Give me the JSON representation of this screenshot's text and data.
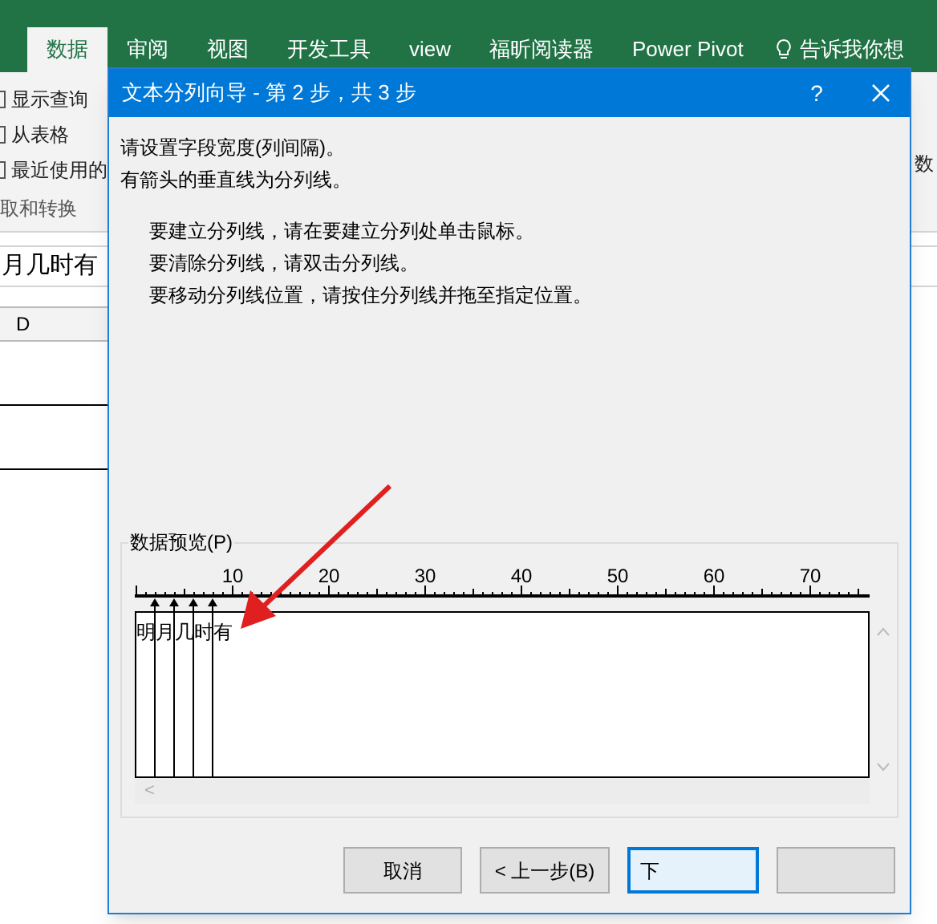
{
  "ribbon_tabs": [
    {
      "label": "数据",
      "selected": true
    },
    {
      "label": "审阅",
      "selected": false
    },
    {
      "label": "视图",
      "selected": false
    },
    {
      "label": "开发工具",
      "selected": false
    },
    {
      "label": "view",
      "selected": false
    },
    {
      "label": "福昕阅读器",
      "selected": false
    },
    {
      "label": "Power Pivot",
      "selected": false
    }
  ],
  "tell_me": "告诉我你想",
  "ribbon_group": {
    "items": [
      "显示查询",
      "从表格",
      "最近使用的"
    ],
    "label": "取和转换"
  },
  "ribbon_right": "数",
  "formula_bar": {
    "value": "月几时有"
  },
  "sheet": {
    "column": "D"
  },
  "dialog": {
    "title": "文本分列向导 - 第 2 步，共 3 步",
    "help": "?",
    "lines": [
      "请设置字段宽度(列间隔)。",
      "有箭头的垂直线为分列线。"
    ],
    "instructions": [
      "要建立分列线，请在要建立分列处单击鼠标。",
      "要清除分列线，请双击分列线。",
      "要移动分列线位置，请按住分列线并拖至指定位置。"
    ],
    "preview": {
      "label": "数据预览(P)",
      "ruler_labels": [
        "10",
        "20",
        "30",
        "40",
        "50",
        "60",
        "70"
      ],
      "columns": [
        "明",
        "月",
        "几",
        "时",
        "有"
      ],
      "scroll_left": "<"
    },
    "buttons": [
      {
        "label": "取消",
        "default": false
      },
      {
        "label": "< 上一步(B)",
        "default": false
      },
      {
        "label": "下",
        "default": true
      },
      {
        "default": false
      }
    ]
  }
}
